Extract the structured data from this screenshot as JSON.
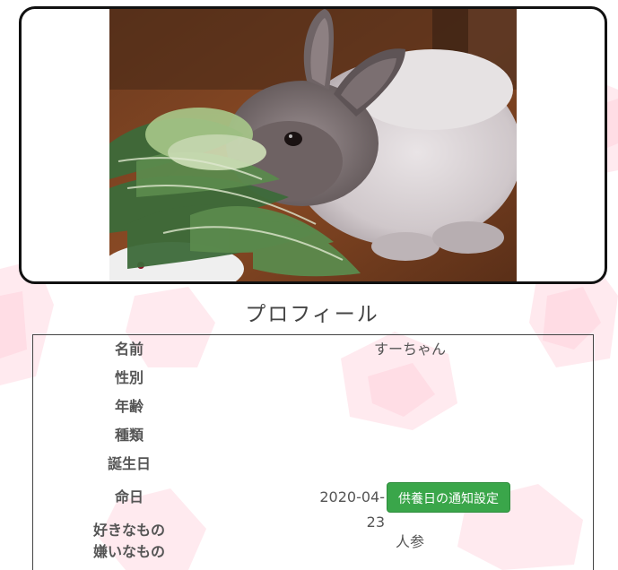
{
  "colors": {
    "frame_border": "#111111",
    "button_green": "#3aa64a",
    "pattern_pink": "#ffdfe6",
    "text_gray": "#555555"
  },
  "photo": {
    "icon": "rabbit-eating-greens-photo"
  },
  "profile": {
    "title": "プロフィール",
    "fields": {
      "name_label": "名前",
      "name_value": "すーちゃん",
      "gender_label": "性別",
      "age_label": "年齢",
      "species_label": "種類",
      "birthday_label": "誕生日",
      "deathday_label": "命日",
      "deathday_value": "2020-04-23",
      "likes_label": "好きなもの",
      "dislikes_label": "嫌いなもの",
      "likes_dislikes_value": "人参"
    },
    "notify_button_label": "供養日の通知設定"
  }
}
